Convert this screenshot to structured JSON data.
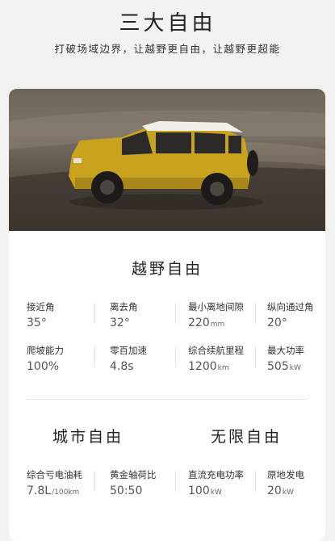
{
  "header": {
    "title": "三大自由",
    "subtitle": "打破场域边界，让越野更自由，让越野更超能"
  },
  "offroad": {
    "title": "越野自由",
    "specs": [
      {
        "label": "接近角",
        "value": "35°",
        "unit": ""
      },
      {
        "label": "离去角",
        "value": "32°",
        "unit": ""
      },
      {
        "label": "最小离地间隙",
        "value": "220",
        "unit": "mm"
      },
      {
        "label": "纵向通过角",
        "value": "20°",
        "unit": ""
      },
      {
        "label": "爬坡能力",
        "value": "100%",
        "unit": ""
      },
      {
        "label": "零百加速",
        "value": "4.8s",
        "unit": ""
      },
      {
        "label": "综合续航里程",
        "value": "1200",
        "unit": "km"
      },
      {
        "label": "最大功率",
        "value": "505",
        "unit": "kW"
      }
    ]
  },
  "city": {
    "title": "城市自由",
    "specs": [
      {
        "label": "综合亏电油耗",
        "value": "7.8L",
        "unit": "/100km"
      },
      {
        "label": "黄金轴荷比",
        "value": "50:50",
        "unit": ""
      }
    ]
  },
  "unlimited": {
    "title": "无限自由",
    "specs": [
      {
        "label": "直流充电功率",
        "value": "100",
        "unit": "kW"
      },
      {
        "label": "原地发电",
        "value": "20",
        "unit": "kW"
      }
    ]
  },
  "colors": {
    "vehicle_body": "#c9a21e",
    "vehicle_roof": "#f2f0ea",
    "terrain": "#6d655b"
  }
}
